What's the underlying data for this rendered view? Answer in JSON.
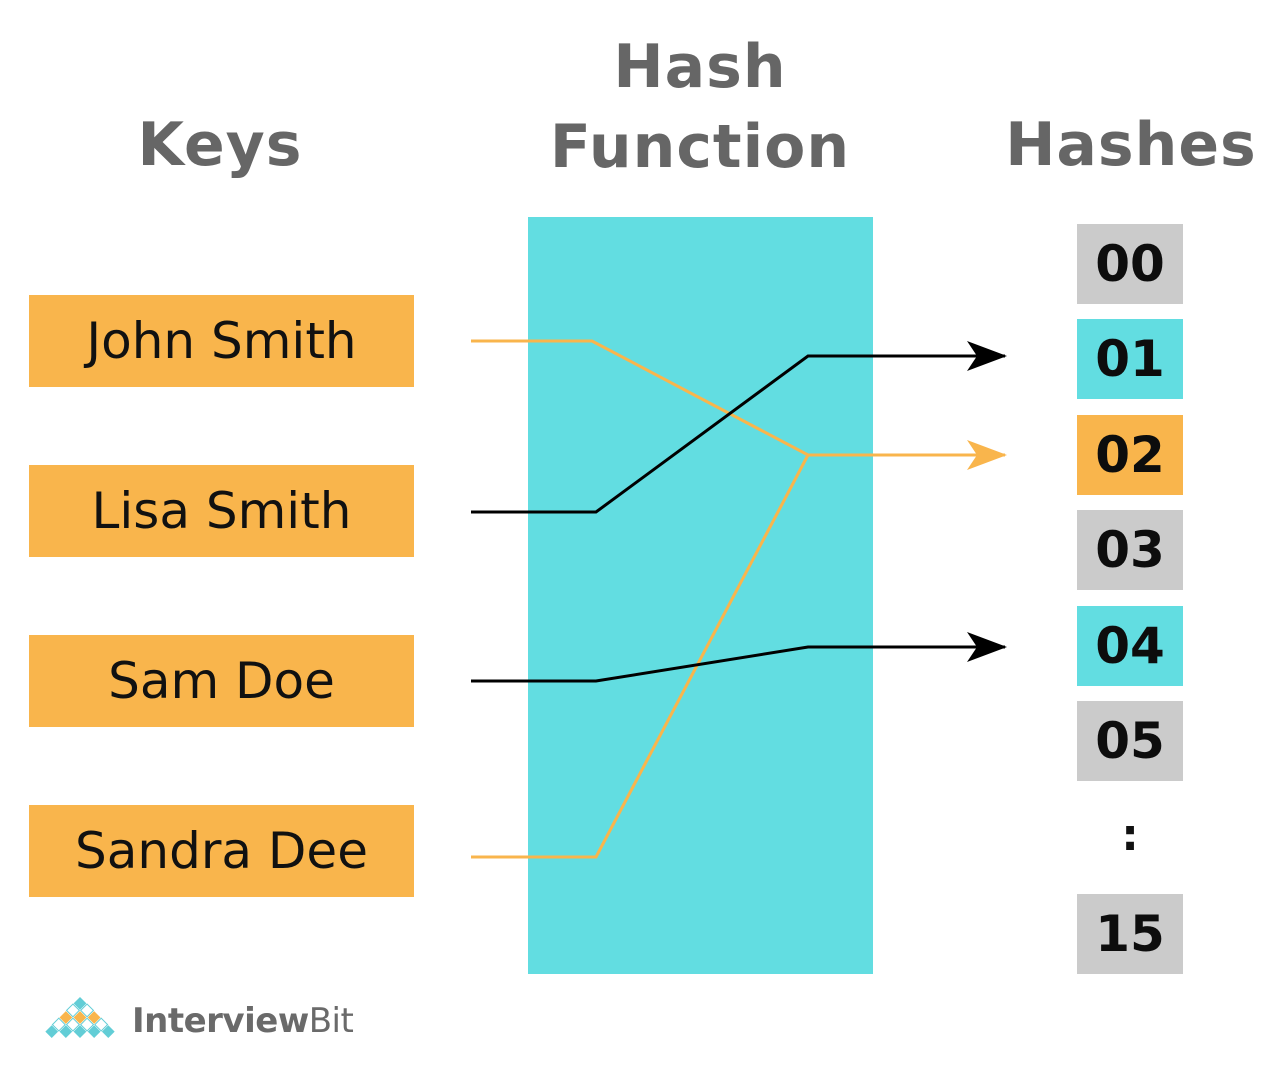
{
  "headings": {
    "keys": "Keys",
    "hash_function": "Hash Function",
    "hashes": "Hashes"
  },
  "keys": [
    {
      "label": "John Smith",
      "hash_index": 2
    },
    {
      "label": "Lisa Smith",
      "hash_index": 1
    },
    {
      "label": "Sam Doe",
      "hash_index": 4
    },
    {
      "label": "Sandra Dee",
      "hash_index": 2
    }
  ],
  "hashes": [
    {
      "label": "00",
      "state": "empty"
    },
    {
      "label": "01",
      "state": "black-mapped"
    },
    {
      "label": "02",
      "state": "orange-mapped"
    },
    {
      "label": "03",
      "state": "empty"
    },
    {
      "label": "04",
      "state": "black-mapped"
    },
    {
      "label": "05",
      "state": "empty"
    },
    {
      "label": ":",
      "state": "ellipsis"
    },
    {
      "label": "15",
      "state": "empty"
    }
  ],
  "mappings": [
    {
      "from": "John Smith",
      "to": "02",
      "color": "#f9b54c"
    },
    {
      "from": "Lisa Smith",
      "to": "01",
      "color": "#000000"
    },
    {
      "from": "Sam Doe",
      "to": "04",
      "color": "#000000"
    },
    {
      "from": "Sandra Dee",
      "to": "02",
      "color": "#f9b54c"
    }
  ],
  "colors": {
    "key_box": "#f9b54c",
    "hash_function": "#62dde1",
    "hash_empty": "#cbcbcb",
    "heading_text": "#666666"
  },
  "logo": {
    "part1": "Interview",
    "part2": "Bit"
  }
}
